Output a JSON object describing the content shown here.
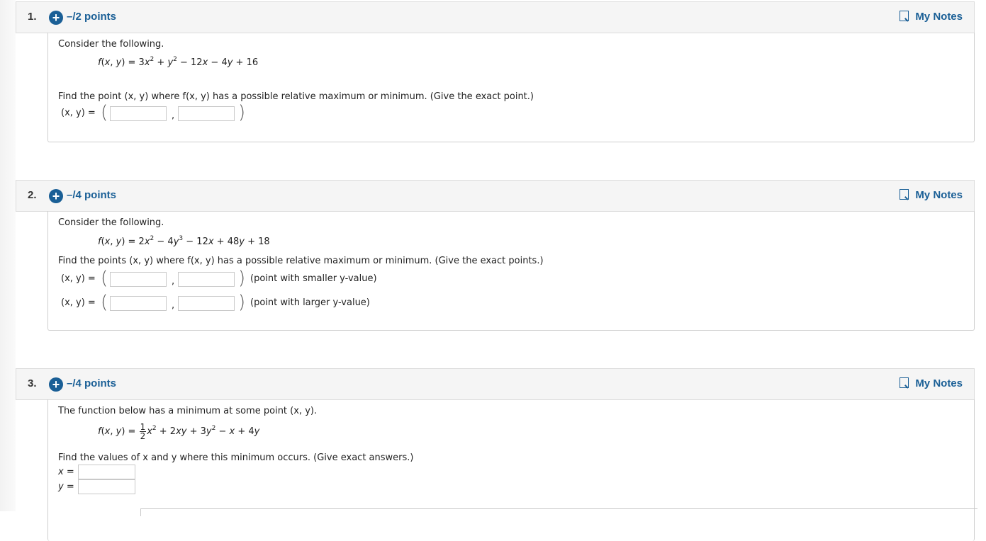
{
  "questions": [
    {
      "number": "1.",
      "points": "–/2 points",
      "notes_label": "My Notes",
      "intro": "Consider the following.",
      "formula": {
        "lhs": "f(x, y)",
        "rhs_parts": [
          "3x",
          "2",
          " + ",
          "y",
          "2",
          " − 12",
          "x",
          " − 4",
          "y",
          " + 16"
        ]
      },
      "prompt": "Find the point (x, y) where f(x, y) has a possible relative maximum or minimum. (Give the exact point.)",
      "answer_rows": [
        {
          "label": "(x, y) =",
          "x_value": "",
          "y_value": "",
          "note": ""
        }
      ]
    },
    {
      "number": "2.",
      "points": "–/4 points",
      "notes_label": "My Notes",
      "intro": "Consider the following.",
      "formula": {
        "lhs": "f(x, y)",
        "rhs": "2x² − 4y³ − 12x + 48y + 18"
      },
      "prompt": "Find the points (x, y) where f(x, y) has a possible relative maximum or minimum. (Give the exact points.)",
      "answer_rows": [
        {
          "label": "(x, y) =",
          "x_value": "",
          "y_value": "",
          "note": "(point with smaller y-value)"
        },
        {
          "label": "(x, y) =",
          "x_value": "",
          "y_value": "",
          "note": "(point with larger y-value)"
        }
      ]
    },
    {
      "number": "3.",
      "points": "–/4 points",
      "notes_label": "My Notes",
      "intro": "The function below has a minimum at some point (x, y).",
      "formula": {
        "lhs": "f(x, y)",
        "frac_num": "1",
        "frac_den": "2",
        "rhs": "x² + 2xy + 3y² − x + 4y"
      },
      "prompt": "Find the values of x and y where this minimum occurs. (Give exact answers.)",
      "answer_rows": [
        {
          "label": "x =",
          "value": ""
        },
        {
          "label": "y =",
          "value": ""
        }
      ]
    }
  ]
}
